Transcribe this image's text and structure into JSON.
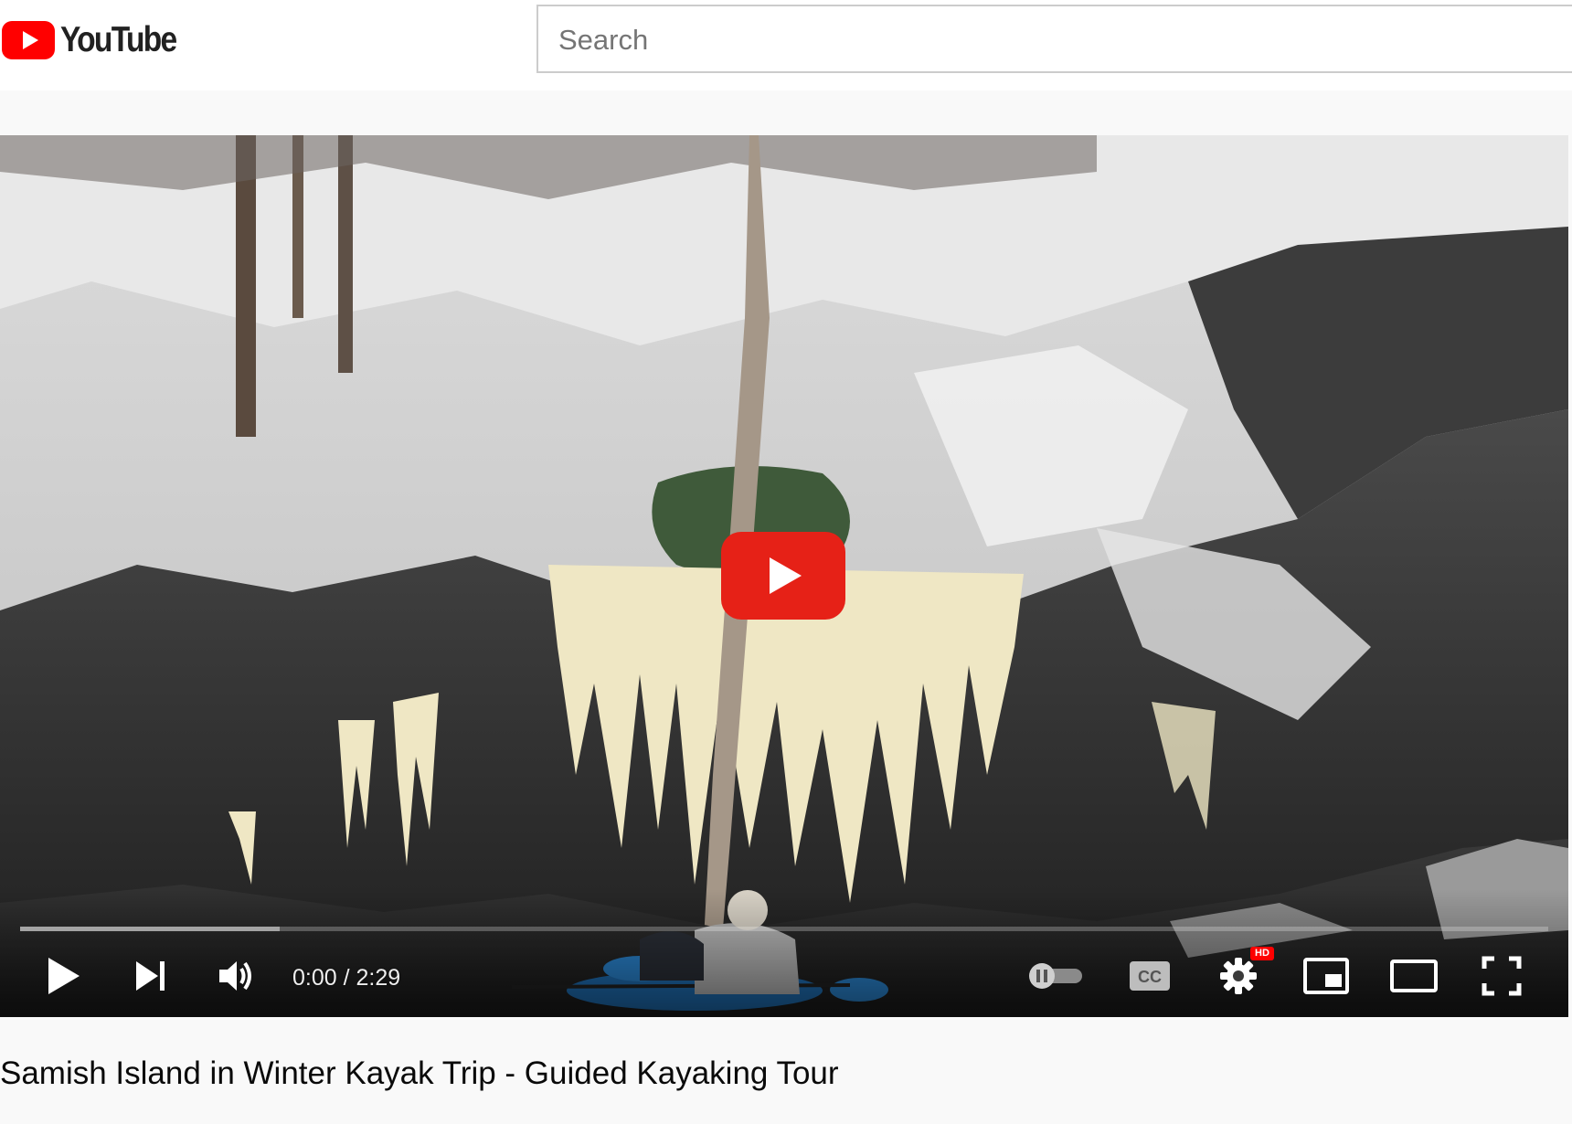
{
  "masthead": {
    "logo_text": "YouTube",
    "search_placeholder": "Search"
  },
  "player": {
    "current_time": "0:00",
    "duration": "2:29",
    "time_display": "0:00 / 2:29",
    "progress_loaded_fraction": 0.17,
    "settings_badge": "HD",
    "accent_color": "#ff0000",
    "icons": [
      "play-icon",
      "next-icon",
      "volume-icon",
      "autoplay-toggle-icon",
      "captions-icon",
      "settings-icon",
      "miniplayer-icon",
      "theater-mode-icon",
      "fullscreen-icon"
    ]
  },
  "video": {
    "title": "Samish Island in Winter Kayak Trip - Guided Kayaking Tour"
  }
}
